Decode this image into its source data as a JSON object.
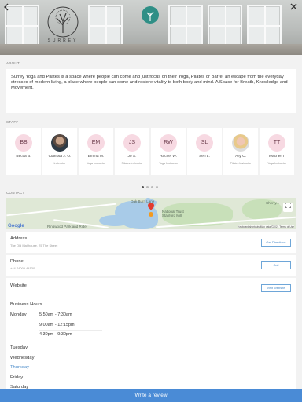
{
  "header": {
    "back_icon": "chevron-left-icon",
    "close_icon": "close-icon",
    "logo_word": "SURREY"
  },
  "about": {
    "label": "ABOUT",
    "text": "Surrey Yoga and Pilates is a space where people can come and just focus on their Yoga, Pilates or Barre, an escape from the everyday stresses of modern living, a place where people can come and restore vitality to both body and mind. A Space for Breath, Knowledge and Movement."
  },
  "staff": {
    "label": "STAFF",
    "members": [
      {
        "initials": "BB",
        "name": "Becca B.",
        "role": ""
      },
      {
        "initials": "",
        "name": "Clarissa J. O.",
        "role": "Instructor",
        "photo": "photo1"
      },
      {
        "initials": "EM",
        "name": "Emma M.",
        "role": "Yoga Instructor"
      },
      {
        "initials": "JS",
        "name": "Jo S.",
        "role": "Pilates Instructor"
      },
      {
        "initials": "RW",
        "name": "Rachel W.",
        "role": "Yoga Instructor"
      },
      {
        "initials": "SL",
        "name": "Seri L.",
        "role": ""
      },
      {
        "initials": "",
        "name": "Ally C.",
        "role": "Pilates Instructor",
        "photo": "photo2"
      },
      {
        "initials": "TT",
        "name": "Teacher T.",
        "role": "Yoga Instructor"
      }
    ],
    "page_count": 4,
    "active_page": 0
  },
  "contact": {
    "label": "CONTACT",
    "map": {
      "labels": [
        "Oak Burn Lane",
        "National Trust Stanford Mill",
        "Ringwood Park and Ride",
        "Cherry..."
      ],
      "google": "Google",
      "attribution": "Keyboard shortcuts   Map data ©2021   Terms of Use"
    },
    "address": {
      "title": "Address",
      "value": "The Old Malthouse, 25 The Street",
      "button": "Get Directions"
    },
    "phone": {
      "title": "Phone",
      "value": "+44 74009 44130",
      "button": "Call"
    },
    "website": {
      "title": "Website",
      "value": "",
      "button": "Visit Website"
    }
  },
  "hours": {
    "title": "Business Hours",
    "days": [
      {
        "day": "Monday",
        "times": [
          "5:50am - 7:30am",
          "9:00am - 12:15pm",
          "4:30pm - 9:30pm"
        ],
        "today": false
      },
      {
        "day": "Tuesday",
        "times": [],
        "today": false
      },
      {
        "day": "Wednesday",
        "times": [],
        "today": false
      },
      {
        "day": "Thursday",
        "times": [],
        "today": true
      },
      {
        "day": "Friday",
        "times": [],
        "today": false
      },
      {
        "day": "Saturday",
        "times": [],
        "today": false
      }
    ]
  },
  "footer": {
    "review_button": "Write a review"
  },
  "colors": {
    "accent": "#4a8bd6",
    "avatar_bg": "#f7d9e2"
  }
}
